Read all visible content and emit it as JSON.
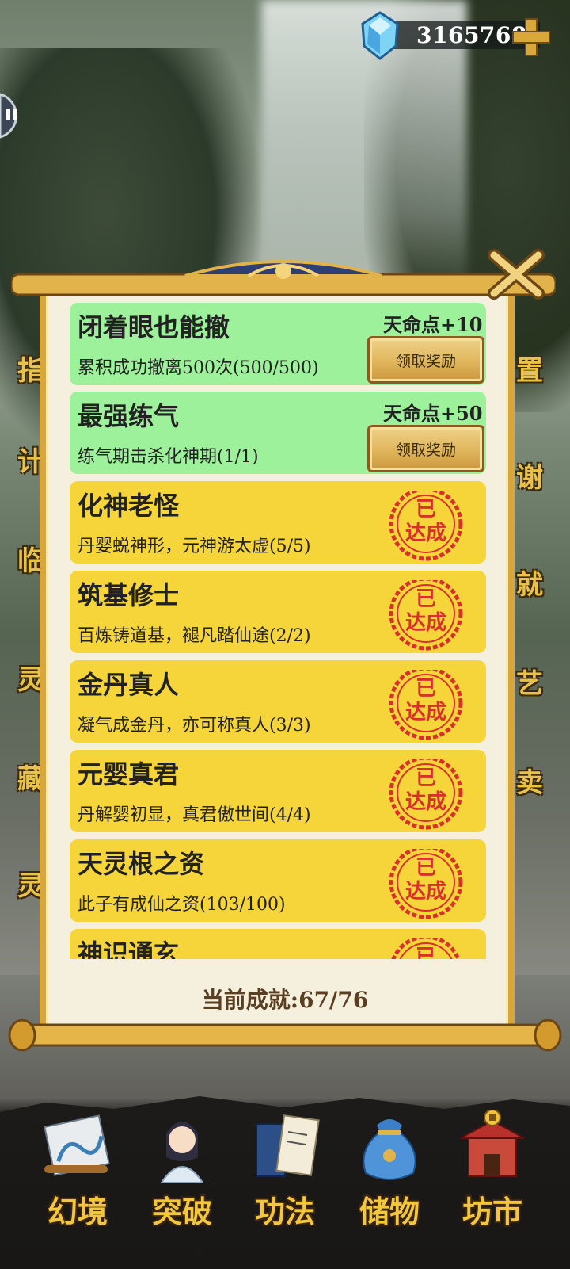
{
  "currency": {
    "amount": "3165768",
    "icon": "diamond-icon",
    "plus_icon": "plus-icon"
  },
  "side_labels": {
    "left": [
      "指",
      "计",
      "临",
      "灵",
      "藏",
      "灵"
    ],
    "right": [
      "置",
      "谢",
      "就",
      "艺",
      "卖"
    ]
  },
  "achievements": [
    {
      "title": "闭着眼也能撤",
      "desc": "累积成功撤离500次(500/500)",
      "status": "claimable",
      "reward": "天命点+10",
      "button": "领取奖励"
    },
    {
      "title": "最强练气",
      "desc": "练气期击杀化神期(1/1)",
      "status": "claimable",
      "reward": "天命点+50",
      "button": "领取奖励"
    },
    {
      "title": "化神老怪",
      "desc": "丹婴蜕神形，元神游太虚(5/5)",
      "status": "done",
      "seal": "已达成"
    },
    {
      "title": "筑基修士",
      "desc": "百炼铸道基，褪凡踏仙途(2/2)",
      "status": "done",
      "seal": "已达成"
    },
    {
      "title": "金丹真人",
      "desc": "凝气成金丹，亦可称真人(3/3)",
      "status": "done",
      "seal": "已达成"
    },
    {
      "title": "元婴真君",
      "desc": "丹解婴初显，真君傲世间(4/4)",
      "status": "done",
      "seal": "已达成"
    },
    {
      "title": "天灵根之资",
      "desc": "此子有成仙之资(103/100)",
      "status": "done",
      "seal": "已达成"
    },
    {
      "title": "神识通玄",
      "desc": "",
      "status": "done",
      "seal": "已达成"
    }
  ],
  "progress_text": "当前成就:67/76",
  "nav": [
    {
      "label": "幻境",
      "icon": "scroll-painting-icon"
    },
    {
      "label": "突破",
      "icon": "cultivator-icon"
    },
    {
      "label": "功法",
      "icon": "book-icon"
    },
    {
      "label": "储物",
      "icon": "pouch-icon"
    },
    {
      "label": "坊市",
      "icon": "market-gate-icon"
    }
  ],
  "colors": {
    "claimable": "#9df19b",
    "done": "#f6d53b",
    "seal": "#d8312c",
    "gold": "#f2c63d"
  }
}
